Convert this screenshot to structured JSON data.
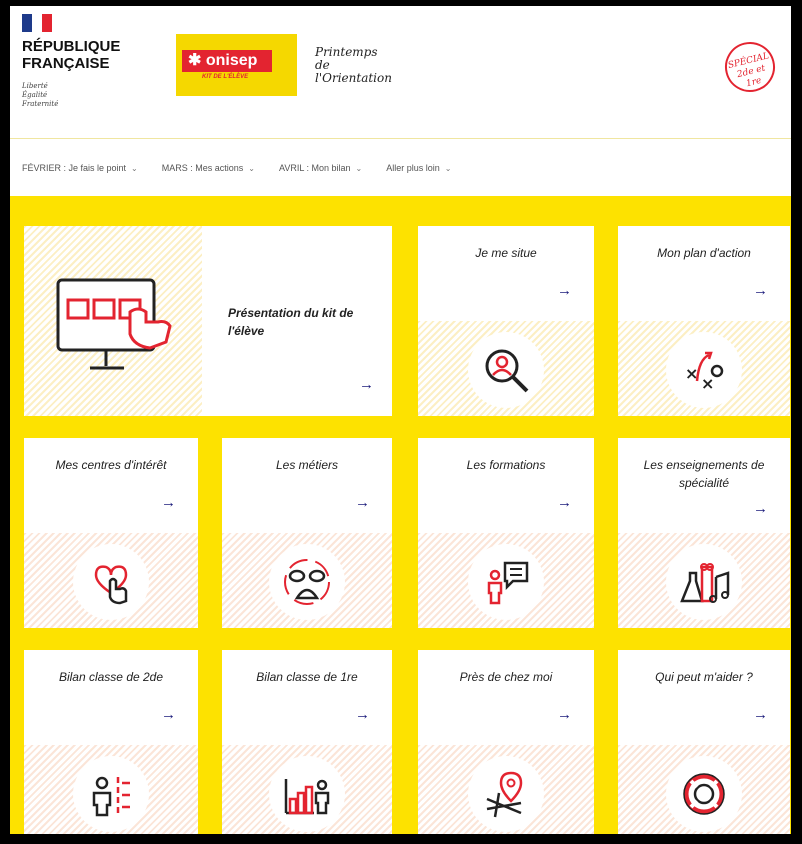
{
  "header": {
    "republic": [
      "RÉPUBLIQUE",
      "FRANÇAISE"
    ],
    "motto": [
      "Liberté",
      "Égalité",
      "Fraternité"
    ],
    "onisep_brand": "onisep",
    "onisep_sub": "KIT DE L'ÉLÈVE",
    "printemps": [
      "Printemps",
      "de l'Orientation"
    ],
    "stamp": [
      "SPÉCIAL",
      "2de et 1re"
    ]
  },
  "nav": [
    {
      "label": "FÉVRIER : Je fais le point"
    },
    {
      "label": "MARS : Mes actions"
    },
    {
      "label": "AVRIL : Mon bilan"
    },
    {
      "label": "Aller plus loin"
    }
  ],
  "featured": {
    "title": "Présentation du kit de l'élève",
    "arrow": "→"
  },
  "cards": [
    {
      "title": "Je me situe",
      "icon": "magnifier-person-icon",
      "arrow": "→"
    },
    {
      "title": "Mon plan d'action",
      "icon": "strategy-icon",
      "arrow": "→"
    },
    {
      "title": "Mes centres d'intérêt",
      "icon": "heart-hand-icon",
      "arrow": "→"
    },
    {
      "title": "Les métiers",
      "icon": "helmets-icon",
      "arrow": "→"
    },
    {
      "title": "Les formations",
      "icon": "person-speech-icon",
      "arrow": "→"
    },
    {
      "title": "Les enseignements de spécialité",
      "icon": "science-arts-icon",
      "arrow": "→"
    },
    {
      "title": "Bilan classe de 2de",
      "icon": "person-checklist-icon",
      "arrow": "→"
    },
    {
      "title": "Bilan classe de 1re",
      "icon": "chart-person-icon",
      "arrow": "→"
    },
    {
      "title": "Près de chez moi",
      "icon": "map-pin-icon",
      "arrow": "→"
    },
    {
      "title": "Qui peut m'aider ?",
      "icon": "lifebuoy-icon",
      "arrow": "→"
    }
  ],
  "colors": {
    "yellow": "#fde200",
    "red": "#e32430",
    "navy": "#1a1a7a",
    "blue": "#1e3a8a"
  }
}
